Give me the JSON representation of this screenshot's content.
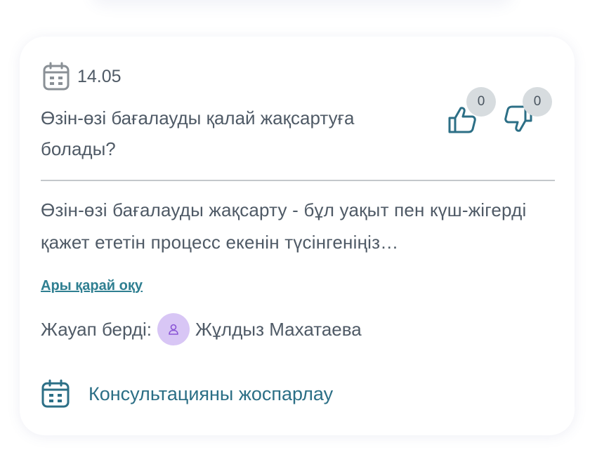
{
  "card": {
    "date": "14.05",
    "question": "Өзін-өзі бағалауды қалай жақсартуға болады?",
    "likes": "0",
    "dislikes": "0",
    "answer_preview": "Өзін-өзі бағалауды жақсарту - бұл уақыт пен күш-жігерді қажет ететін процесс екенін түсінгеніңіз…",
    "read_more": "Ары қарай оқу",
    "answered_label": "Жауап берді:",
    "answerer_name": "Жұлдыз Махатаева",
    "consult_label": "Консультацияны жоспарлау"
  },
  "icons": {
    "date": "calendar-icon",
    "like": "thumbs-up-icon",
    "dislike": "thumbs-down-icon",
    "avatar": "user-icon",
    "consult": "calendar-icon"
  },
  "colors": {
    "accent": "#2f7f91",
    "consult_text": "#2c6f86",
    "text": "#4f5a66",
    "avatar_bg": "#d8c6f5",
    "avatar_icon": "#8a55d6",
    "count_badge": "#d7dcdf",
    "divider": "#c4c7cb"
  }
}
